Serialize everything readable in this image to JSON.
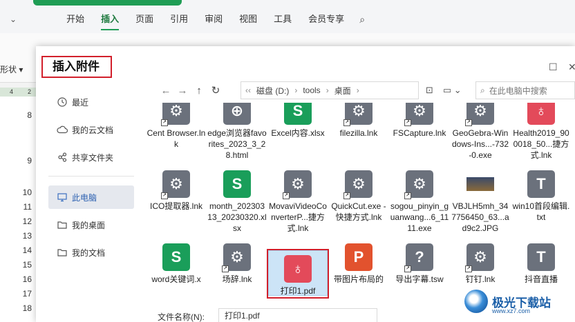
{
  "app": {
    "tabs": [
      "开始",
      "插入",
      "页面",
      "引用",
      "审阅",
      "视图",
      "工具",
      "会员专享"
    ],
    "active_tab": "插入",
    "shape_label": "形状",
    "ruler_marks": [
      "4",
      "2"
    ],
    "row_numbers": [
      "8",
      "9",
      "10",
      "11",
      "12",
      "13",
      "14",
      "15",
      "16",
      "17",
      "18"
    ]
  },
  "dialog": {
    "title": "插入附件",
    "sidebar": [
      {
        "label": "最近",
        "icon": "clock-icon"
      },
      {
        "label": "我的云文档",
        "icon": "cloud-icon"
      },
      {
        "label": "共享文件夹",
        "icon": "share-icon"
      },
      {
        "label": "此电脑",
        "icon": "computer-icon",
        "active": true
      },
      {
        "label": "我的桌面",
        "icon": "folder-icon"
      },
      {
        "label": "我的文档",
        "icon": "folder-icon"
      }
    ],
    "breadcrumb": [
      "磁盘 (D:)",
      "tools",
      "桌面"
    ],
    "search_placeholder": "在此电脑中搜索",
    "files": [
      {
        "name": "Cent Browser.lnk",
        "type": "gear"
      },
      {
        "name": "edge浏览器favorites_2023_3_28.html",
        "type": "globe"
      },
      {
        "name": "Excel内容.xlsx",
        "type": "sheet"
      },
      {
        "name": "filezilla.lnk",
        "type": "gear"
      },
      {
        "name": "FSCapture.lnk",
        "type": "gear"
      },
      {
        "name": "GeoGebra-Windows-Ins...-732-0.exe",
        "type": "gear"
      },
      {
        "name": "Health2019_900018_50...捷方式.lnk",
        "type": "pdf"
      },
      {
        "name": "ICO提取器.lnk",
        "type": "gear"
      },
      {
        "name": "month_20230313_20230320.xlsx",
        "type": "sheet"
      },
      {
        "name": "MovaviVideoConverterP...捷方式.lnk",
        "type": "gear"
      },
      {
        "name": "QuickCut.exe - 快捷方式.lnk",
        "type": "gear"
      },
      {
        "name": "sogou_pinyin_guanwang...6_1111.exe",
        "type": "gear"
      },
      {
        "name": "VBJLH5mh_347756450_63...ad9c2.JPG",
        "type": "photo"
      },
      {
        "name": "win10首段编辑.txt",
        "type": "text"
      },
      {
        "name": "word关键词.x",
        "type": "sheet"
      },
      {
        "name": "场辞.lnk",
        "type": "gear"
      },
      {
        "name": "打印1.pdf",
        "type": "pdf",
        "selected": true
      },
      {
        "name": "带图片布局的",
        "type": "ppt"
      },
      {
        "name": "导出字幕.tsw",
        "type": "q"
      },
      {
        "name": "钉钉.lnk",
        "type": "gear"
      },
      {
        "name": "抖音直播",
        "type": "text"
      }
    ],
    "filename_label": "文件名称(N):",
    "filename_value": "打印1.pdf"
  },
  "watermark": {
    "text": "极光下载站",
    "url": "www.xz7.com"
  }
}
